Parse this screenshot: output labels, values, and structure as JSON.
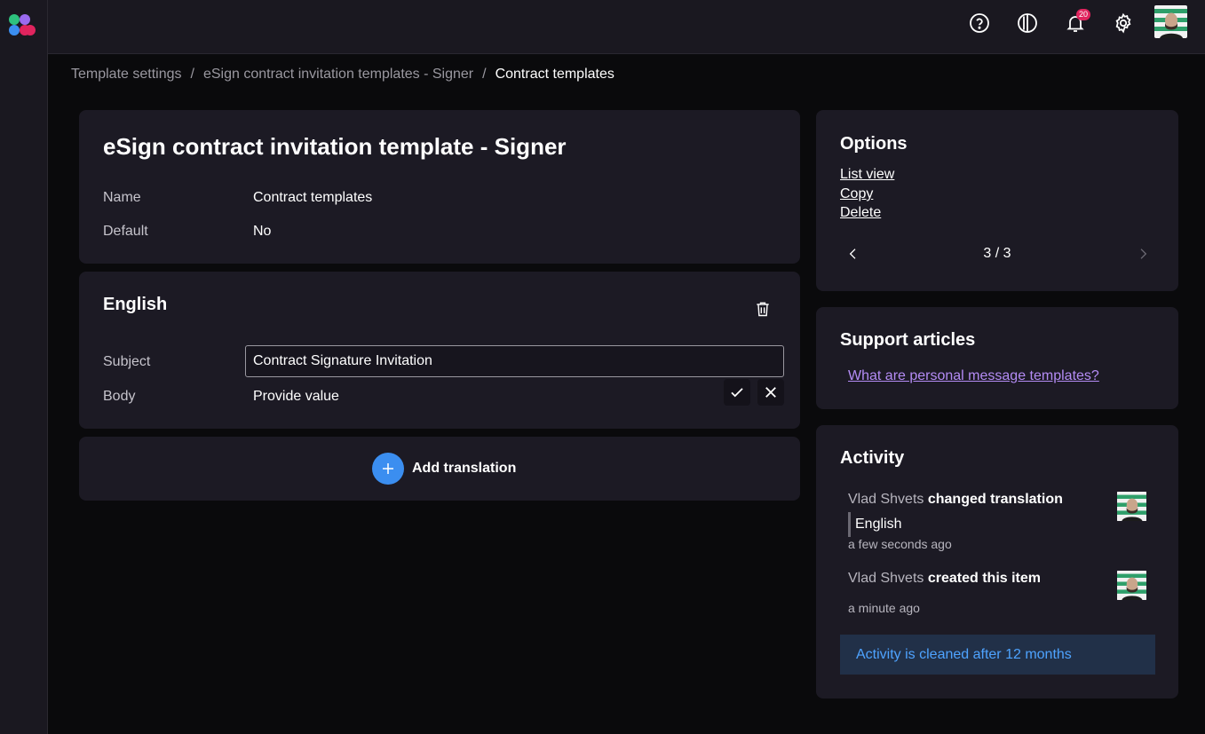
{
  "icons": {
    "logo": "app-logo-icon",
    "help": "help-circle-icon",
    "theme": "contrast-icon",
    "notifications": "bell-icon",
    "settings": "gear-icon",
    "delete": "trash-icon",
    "confirm": "check-icon",
    "cancel": "close-icon",
    "add": "plus-icon",
    "prev": "chevron-left-icon",
    "next": "chevron-right-icon"
  },
  "colors": {
    "accent": "#3b8ef0",
    "badge": "#e0245e",
    "link": "#b48cf5",
    "notice_bg": "#213048",
    "notice_text": "#4ea3ff",
    "card_bg": "#1c1a24",
    "page_bg": "#0a0a0c"
  },
  "header": {
    "notification_count": "20"
  },
  "breadcrumb": [
    {
      "label": "Template settings"
    },
    {
      "label": "eSign contract invitation templates - Signer"
    },
    {
      "label": "Contract templates"
    }
  ],
  "template": {
    "title": "eSign contract invitation template - Signer",
    "name_label": "Name",
    "name_value": "Contract templates",
    "default_label": "Default",
    "default_value": "No"
  },
  "translation": {
    "language": "English",
    "subject_label": "Subject",
    "subject_value": "Contract Signature Invitation",
    "body_label": "Body",
    "body_value": "Provide value"
  },
  "add_translation": {
    "label": "Add translation"
  },
  "options": {
    "title": "Options",
    "links": [
      "List view",
      "Copy",
      "Delete"
    ],
    "pager": "3 / 3"
  },
  "support": {
    "title": "Support articles",
    "link": "What are personal message templates?"
  },
  "activity": {
    "title": "Activity",
    "items": [
      {
        "user": "Vlad Shvets",
        "action": "changed translation",
        "detail": "English",
        "time": "a few seconds ago"
      },
      {
        "user": "Vlad Shvets",
        "action": "created this item",
        "time": "a minute ago"
      }
    ],
    "notice": "Activity is cleaned after 12 months"
  }
}
